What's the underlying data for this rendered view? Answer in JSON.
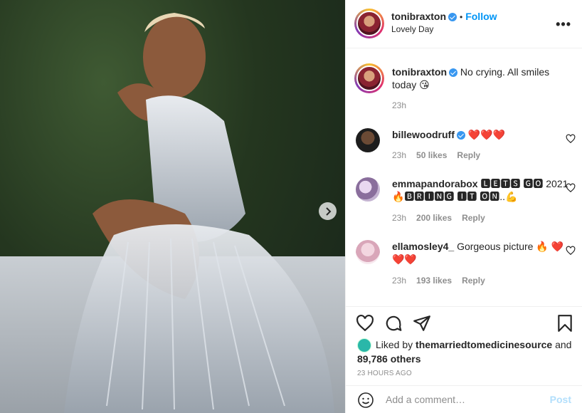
{
  "post": {
    "username": "tonibraxton",
    "follow_label": "Follow",
    "dot": "•",
    "subtitle": "Lovely Day",
    "more": "•••"
  },
  "comments": [
    {
      "user": "tonibraxton",
      "text": "No crying. All smiles today 😘",
      "time": "23h",
      "likes": "",
      "reply": ""
    },
    {
      "user": "billewoodruff",
      "text": "❤️❤️❤️",
      "time": "23h",
      "likes": "50 likes",
      "reply": "Reply"
    },
    {
      "user": "emmapandorabox",
      "text": "🅻🅴🆃🆂 🅶🅾 2021🔥🅱🆁🅸🅽🅶 🅸🆃 🅾🅽..💪",
      "time": "23h",
      "likes": "200 likes",
      "reply": "Reply"
    },
    {
      "user": "ellamosley4_",
      "text": "Gorgeous picture 🔥 ❤️❤️❤️",
      "time": "23h",
      "likes": "193 likes",
      "reply": "Reply"
    }
  ],
  "likes": {
    "prefix": "Liked by",
    "user": "themarriedtomedicinesource",
    "and": "and",
    "others": "89,786 others"
  },
  "timestamp": "23 HOURS AGO",
  "comment_box": {
    "placeholder": "Add a comment…",
    "post_label": "Post"
  },
  "icons": [
    "heart-icon",
    "comment-icon",
    "share-icon",
    "bookmark-icon",
    "emoji-icon",
    "more-icon",
    "chevron-right-icon",
    "verified-icon"
  ],
  "colors": {
    "accent": "#0095f6",
    "verified": "#3897f0",
    "muted": "#8e8e8e",
    "post_disabled": "#b2dffc"
  }
}
